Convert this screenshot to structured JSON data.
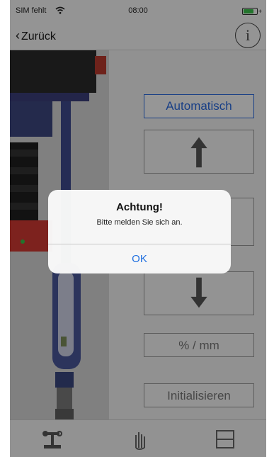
{
  "status_bar": {
    "carrier": "SIM fehlt",
    "time": "08:00"
  },
  "nav": {
    "back_label": "Zurück",
    "info_glyph": "i"
  },
  "controls": {
    "mode_label": "Automatisch",
    "up_icon": "arrow-up-icon",
    "down_icon": "arrow-down-icon",
    "unit_label": "% / mm",
    "init_label": "Initialisieren"
  },
  "tabbar": {
    "icons": [
      "robot-arm-icon",
      "hand-icon",
      "panel-icon"
    ]
  },
  "alert": {
    "title": "Achtung!",
    "message": "Bitte melden Sie sich an.",
    "ok_label": "OK"
  },
  "colors": {
    "accent": "#2a6adf",
    "alert_button": "#1f6fe0",
    "battery": "#39c24a"
  }
}
